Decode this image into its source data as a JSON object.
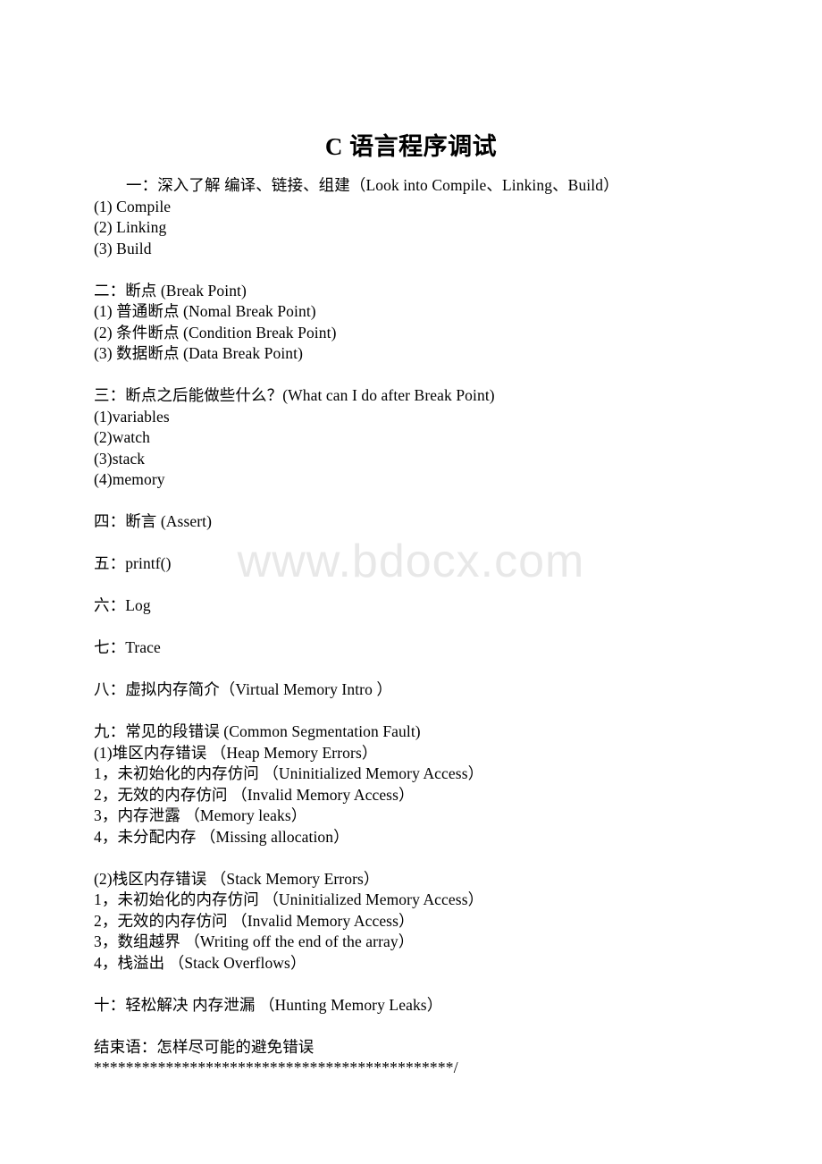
{
  "document": {
    "title": "C 语言程序调试",
    "watermark": "www.bdocx.com",
    "sections": [
      {
        "heading": "一：深入了解 编译、链接、组建（Look into Compile、Linking、Build）",
        "heading_indented": true,
        "items": [
          "(1) Compile",
          "(2) Linking",
          "(3) Build"
        ]
      },
      {
        "heading": "二：断点 (Break Point)",
        "heading_indented": false,
        "items": [
          "(1) 普通断点 (Nomal Break Point)",
          "(2) 条件断点 (Condition Break Point)",
          "(3) 数据断点 (Data Break Point)"
        ]
      },
      {
        "heading": "三：断点之后能做些什么？(What can I do after Break Point)",
        "heading_indented": false,
        "items": [
          "(1)variables",
          "(2)watch",
          "(3)stack",
          "(4)memory"
        ]
      },
      {
        "heading": "四：断言 (Assert)",
        "heading_indented": false,
        "items": []
      },
      {
        "heading": "五：printf()",
        "heading_indented": false,
        "items": []
      },
      {
        "heading": "六：Log",
        "heading_indented": false,
        "items": []
      },
      {
        "heading": "七：Trace",
        "heading_indented": false,
        "items": []
      },
      {
        "heading": "八：虚拟内存简介（Virtual Memory Intro ）",
        "heading_indented": false,
        "items": []
      },
      {
        "heading": "九：常见的段错误 (Common Segmentation Fault)",
        "heading_indented": false,
        "items": [
          "(1)堆区内存错误 （Heap Memory Errors）",
          "1，未初始化的内存仿问 （Uninitialized Memory Access）",
          "2，无效的内存仿问 （Invalid Memory Access）",
          "3，内存泄露 （Memory leaks）",
          "4，未分配内存 （Missing allocation）",
          "",
          "(2)栈区内存错误 （Stack Memory Errors）",
          "1，未初始化的内存仿问 （Uninitialized Memory Access）",
          "2，无效的内存仿问 （Invalid Memory Access）",
          "3，数组越界 （Writing off the end of the array）",
          "4，栈溢出 （Stack Overflows）"
        ]
      },
      {
        "heading": "十：轻松解决 内存泄漏 （Hunting Memory Leaks）",
        "heading_indented": false,
        "items": []
      }
    ],
    "closing": {
      "line": "结束语：怎样尽可能的避免错误",
      "separator": "*********************************************/"
    }
  }
}
